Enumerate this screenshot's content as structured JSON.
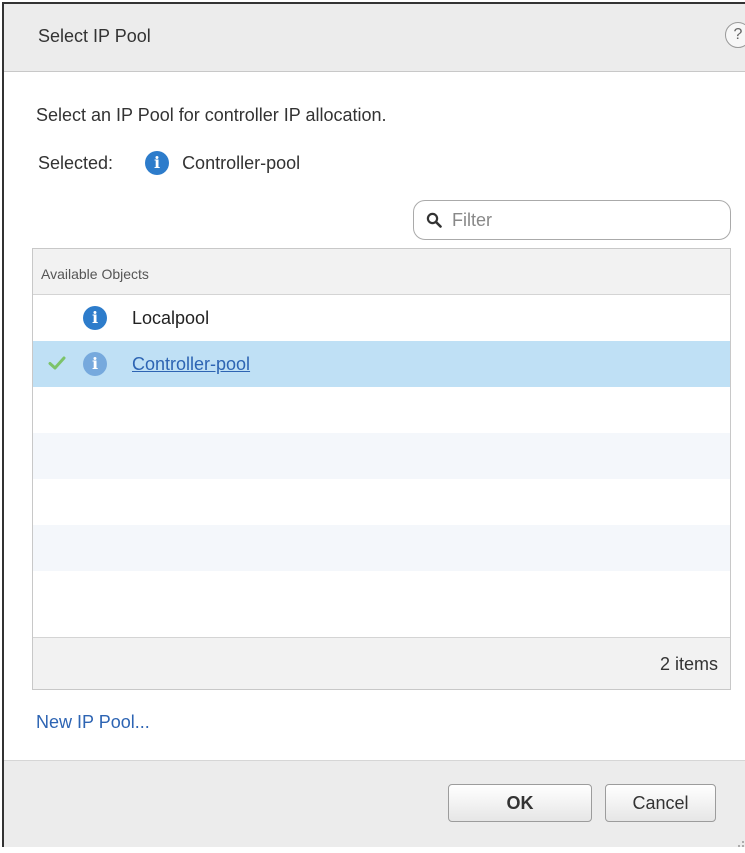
{
  "dialog": {
    "title": "Select IP Pool",
    "help_glyph": "?",
    "instruction": "Select an IP Pool for controller IP allocation.",
    "selected_label": "Selected:",
    "selected_value": "Controller-pool",
    "filter_placeholder": "Filter",
    "grid": {
      "header": "Available Objects",
      "rows": [
        {
          "label": "Localpool",
          "selected": false,
          "icon": "info-icon"
        },
        {
          "label": "Controller-pool",
          "selected": true,
          "icon": "info-icon"
        }
      ],
      "count_text": "2 items"
    },
    "new_link": "New IP Pool...",
    "ok_label": "OK",
    "cancel_label": "Cancel"
  },
  "colors": {
    "accent": "#2d7ccb",
    "link": "#2d64b3",
    "selected_row": "#bfe0f5",
    "check": "#7cc36a"
  }
}
